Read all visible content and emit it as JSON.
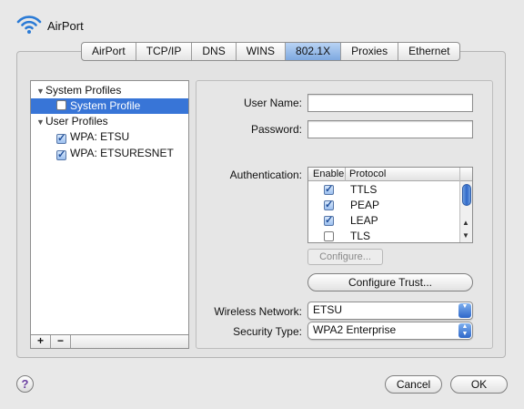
{
  "header": {
    "title": "AirPort",
    "icon": "wifi-icon"
  },
  "tabs": [
    {
      "label": "AirPort",
      "active": false
    },
    {
      "label": "TCP/IP",
      "active": false
    },
    {
      "label": "DNS",
      "active": false
    },
    {
      "label": "WINS",
      "active": false
    },
    {
      "label": "802.1X",
      "active": true
    },
    {
      "label": "Proxies",
      "active": false
    },
    {
      "label": "Ethernet",
      "active": false
    }
  ],
  "profiles": {
    "system_group": "System Profiles",
    "system_profile": "System Profile",
    "user_group": "User Profiles",
    "user_items": [
      {
        "label": "WPA: ETSU",
        "checked": true
      },
      {
        "label": "WPA: ETSURESNET",
        "checked": true
      }
    ],
    "add_label": "+",
    "remove_label": "−"
  },
  "form": {
    "username_label": "User Name:",
    "username_value": "",
    "password_label": "Password:",
    "password_value": "",
    "authentication_label": "Authentication:",
    "configure_label": "Configure...",
    "configure_trust_label": "Configure Trust...",
    "wireless_network_label": "Wireless Network:",
    "wireless_network_value": "ETSU",
    "security_type_label": "Security Type:",
    "security_type_value": "WPA2 Enterprise"
  },
  "protocol_table": {
    "col_enable": "Enable",
    "col_protocol": "Protocol",
    "rows": [
      {
        "name": "TTLS",
        "enabled": true
      },
      {
        "name": "PEAP",
        "enabled": true
      },
      {
        "name": "LEAP",
        "enabled": true
      },
      {
        "name": "TLS",
        "enabled": false
      }
    ]
  },
  "footer": {
    "help_label": "?",
    "cancel_label": "Cancel",
    "ok_label": "OK"
  },
  "colors": {
    "selection": "#3875d7",
    "active_tab": "#9fc0ec",
    "help_icon": "#6b3fa0"
  }
}
